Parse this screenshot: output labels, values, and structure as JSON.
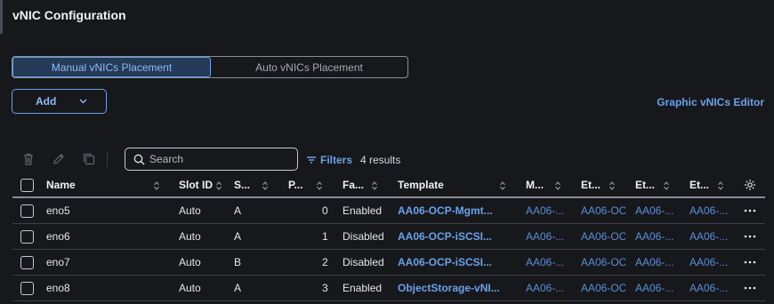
{
  "section": {
    "title": "vNIC Configuration"
  },
  "placement": {
    "options": [
      "Manual vNICs Placement",
      "Auto vNICs Placement"
    ],
    "selected": "Manual vNICs Placement"
  },
  "actions": {
    "add_label": "Add",
    "graphic_editor_label": "Graphic vNICs Editor"
  },
  "toolbar": {
    "search_placeholder": "Search",
    "filters_label": "Filters",
    "results_text": "4 results"
  },
  "table": {
    "columns": [
      "Name",
      "Slot ID",
      "S...",
      "P...",
      "Fa...",
      "Template",
      "M...",
      "Et...",
      "Et...",
      "Et..."
    ],
    "rows": [
      {
        "name": "eno5",
        "slot": "Auto",
        "switch": "A",
        "pci": "0",
        "failover": "Enabled",
        "template": "AA06-OCP-Mgmt...",
        "m": "AA06-...",
        "e1": "AA06-OC",
        "e2": "AA06-...",
        "e3": "AA06-..."
      },
      {
        "name": "eno6",
        "slot": "Auto",
        "switch": "A",
        "pci": "1",
        "failover": "Disabled",
        "template": "AA06-OCP-iSCSI...",
        "m": "AA06-...",
        "e1": "AA06-OC",
        "e2": "AA06-...",
        "e3": "AA06-..."
      },
      {
        "name": "eno7",
        "slot": "Auto",
        "switch": "B",
        "pci": "2",
        "failover": "Disabled",
        "template": "AA06-OCP-iSCSI...",
        "m": "AA06-...",
        "e1": "AA06-OC",
        "e2": "AA06-...",
        "e3": "AA06-..."
      },
      {
        "name": "eno8",
        "slot": "Auto",
        "switch": "A",
        "pci": "3",
        "failover": "Enabled",
        "template": "ObjectStorage-vNI...",
        "m": "AA06-...",
        "e1": "AA06-OC",
        "e2": "AA06-...",
        "e3": "AA06-..."
      }
    ]
  },
  "icons": {
    "delete": "trash-icon",
    "edit": "pencil-icon",
    "clone": "copy-icon",
    "search": "search-icon",
    "filter": "filter-icon",
    "settings": "gear-icon",
    "row_menu": "kebab-icon"
  },
  "colors": {
    "background": "#17181c",
    "accent": "#6aa2e8"
  }
}
